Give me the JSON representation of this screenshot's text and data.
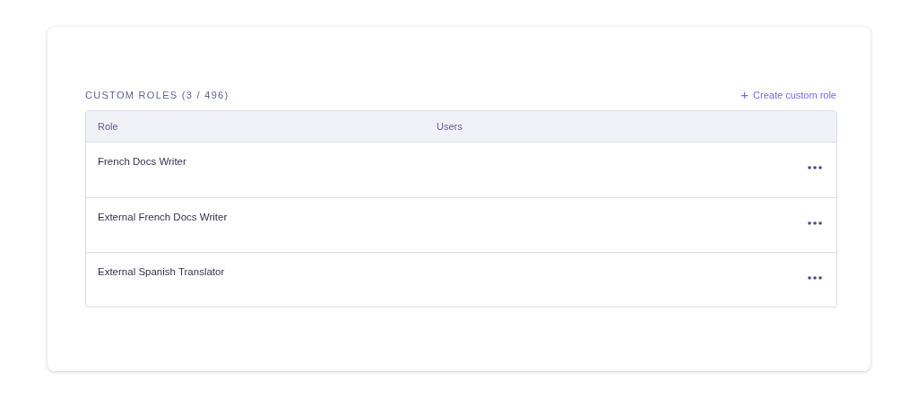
{
  "section": {
    "title": "CUSTOM ROLES (3 / 496)",
    "create_action": {
      "icon": "+",
      "label": "Create custom role"
    }
  },
  "table": {
    "columns": [
      "Role",
      "Users"
    ],
    "rows": [
      {
        "role": "French Docs Writer"
      },
      {
        "role": "External French Docs Writer"
      },
      {
        "role": "External Spanish Translator"
      }
    ]
  }
}
